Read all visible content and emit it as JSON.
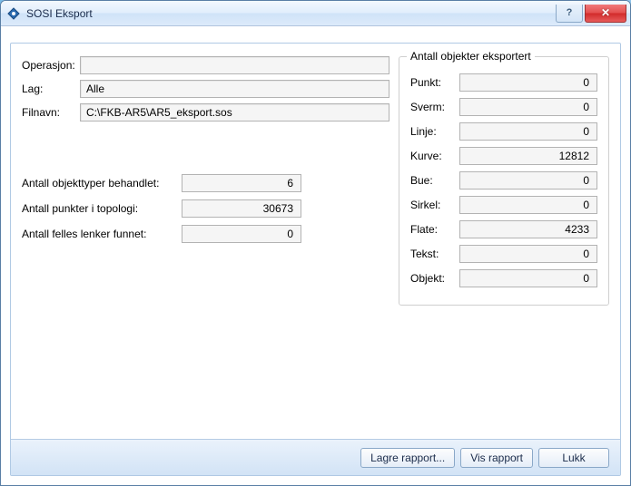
{
  "window": {
    "title": "SOSI Eksport"
  },
  "labels": {
    "operasjon": "Operasjon:",
    "lag": "Lag:",
    "filnavn": "Filnavn:",
    "objekttyper": "Antall objekttyper behandlet:",
    "punkter_topologi": "Antall punkter i topologi:",
    "felles_lenker": "Antall felles lenker funnet:"
  },
  "values": {
    "operasjon": "",
    "lag": "Alle",
    "filnavn": "C:\\FKB-AR5\\AR5_eksport.sos",
    "objekttyper": "6",
    "punkter_topologi": "30673",
    "felles_lenker": "0"
  },
  "group": {
    "title": "Antall objekter eksportert",
    "labels": {
      "punkt": "Punkt:",
      "sverm": "Sverm:",
      "linje": "Linje:",
      "kurve": "Kurve:",
      "bue": "Bue:",
      "sirkel": "Sirkel:",
      "flate": "Flate:",
      "tekst": "Tekst:",
      "objekt": "Objekt:"
    },
    "values": {
      "punkt": "0",
      "sverm": "0",
      "linje": "0",
      "kurve": "12812",
      "bue": "0",
      "sirkel": "0",
      "flate": "4233",
      "tekst": "0",
      "objekt": "0"
    }
  },
  "buttons": {
    "lagre": "Lagre rapport...",
    "vis": "Vis rapport",
    "lukk": "Lukk"
  }
}
